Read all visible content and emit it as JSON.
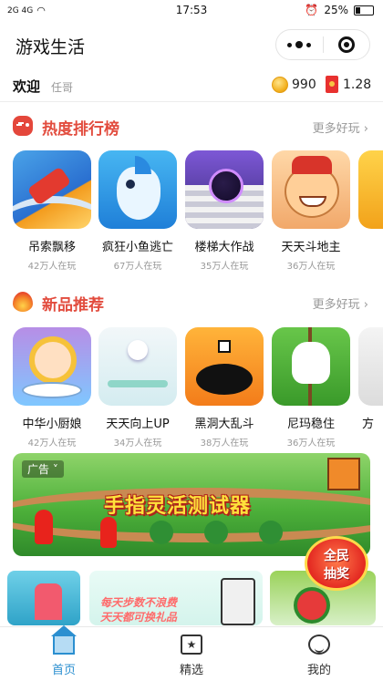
{
  "status_bar": {
    "signal_left": "2G  4G",
    "time": "17:53",
    "battery": "25%",
    "battery_level": 0.25
  },
  "header": {
    "title": "游戏生活"
  },
  "welcome": {
    "greeting": "欢迎",
    "username": "任哥",
    "coins": "990",
    "red_packet": "1.28"
  },
  "sections": {
    "hot": {
      "title": "热度排行榜",
      "more": "更多好玩",
      "games": [
        {
          "name": "吊索飘移",
          "plays": "42万人在玩"
        },
        {
          "name": "疯狂小鱼逃亡",
          "plays": "67万人在玩"
        },
        {
          "name": "楼梯大作战",
          "plays": "35万人在玩"
        },
        {
          "name": "天天斗地主",
          "plays": "36万人在玩"
        }
      ]
    },
    "new": {
      "title": "新品推荐",
      "more": "更多好玩",
      "games": [
        {
          "name": "中华小厨娘",
          "plays": "42万人在玩"
        },
        {
          "name": "天天向上UP",
          "plays": "34万人在玩"
        },
        {
          "name": "黑洞大乱斗",
          "plays": "38万人在玩"
        },
        {
          "name": "尼玛稳住",
          "plays": "36万人在玩"
        }
      ],
      "peek_label": "方"
    }
  },
  "ad": {
    "tag": "广告",
    "headline": "手指灵活测试器"
  },
  "badge": {
    "line1": "全民",
    "line2": "抽奖"
  },
  "promo": {
    "line1": "每天步数不浪费",
    "line2": "天天都可换礼品"
  },
  "tabs": [
    {
      "label": "首页",
      "icon": "home-icon",
      "active": true
    },
    {
      "label": "精选",
      "icon": "star-icon",
      "active": false
    },
    {
      "label": "我的",
      "icon": "smiley-icon",
      "active": false
    }
  ],
  "colors": {
    "section_title": "#e24c3e",
    "tab_active": "#2b8fd0"
  }
}
